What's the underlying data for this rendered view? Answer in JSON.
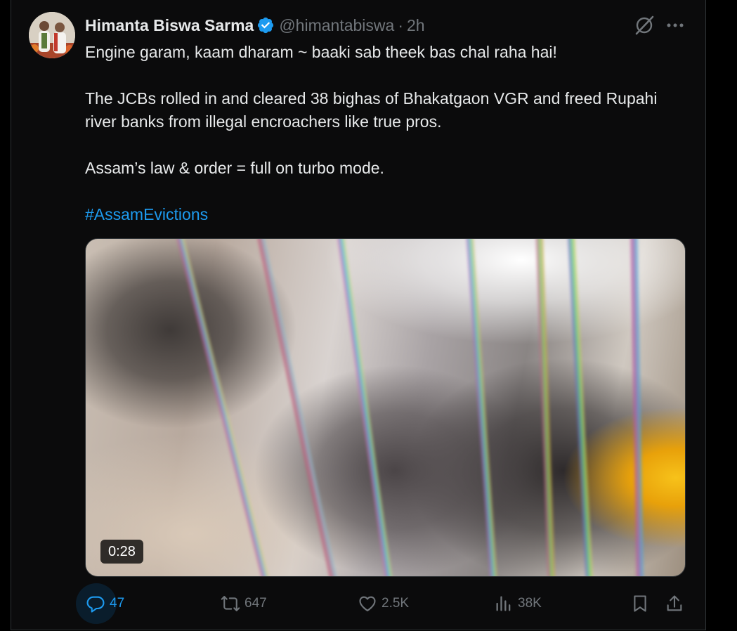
{
  "tweet": {
    "author_name": "Himanta Biswa Sarma",
    "handle": "@himantabiswa",
    "separator": "·",
    "time": "2h",
    "text_lines": [
      "Engine garam, kaam dharam ~ baaki sab theek bas chal raha hai!",
      "The JCBs rolled in and cleared 38 bighas of Bhakatgaon VGR and freed Rupahi",
      "river banks from illegal encroachers like true pros.",
      "Assam’s law & order = full on turbo mode."
    ],
    "hashtag": "#AssamEvictions",
    "media": {
      "type": "video",
      "duration": "0:28"
    }
  },
  "actions": {
    "replies": "47",
    "reposts": "647",
    "likes": "2.5K",
    "views": "38K"
  },
  "colors": {
    "accent": "#1d9bf0",
    "muted": "#71767b",
    "text": "#e7e9ea",
    "background": "#0b0b0c"
  },
  "icons": [
    "verified-badge-icon",
    "grok-icon",
    "more-options-icon",
    "reply-icon",
    "repost-icon",
    "like-icon",
    "views-icon",
    "bookmark-icon",
    "share-icon"
  ]
}
